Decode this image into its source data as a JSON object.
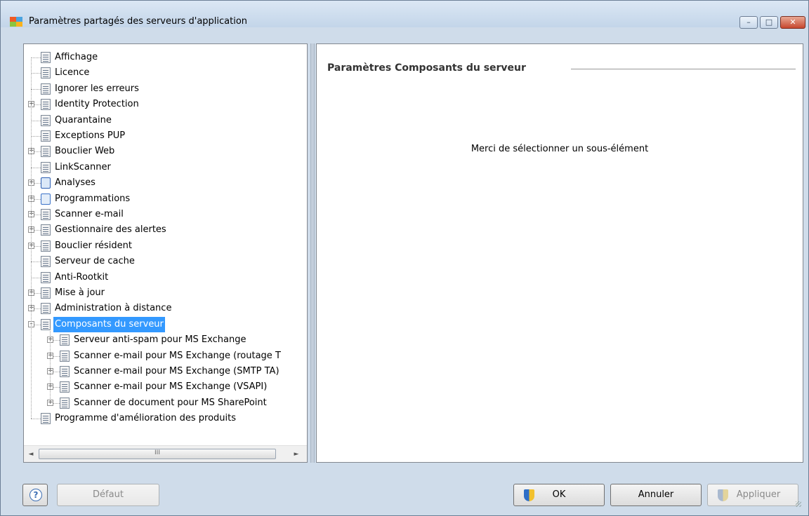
{
  "window": {
    "title": "Paramètres partagés des serveurs d'application",
    "controls": {
      "minimize": "–",
      "maximize": "□",
      "close": "✕"
    },
    "icon_colors": [
      "#f05a23",
      "#4aa3df",
      "#8bc53f",
      "#f9b21d"
    ]
  },
  "tree": {
    "items": [
      {
        "label": "Affichage",
        "expander": "",
        "icon": "document-icon",
        "level": 0
      },
      {
        "label": "Licence",
        "expander": "",
        "icon": "document-icon",
        "level": 0
      },
      {
        "label": "Ignorer les erreurs",
        "expander": "",
        "icon": "document-icon",
        "level": 0
      },
      {
        "label": "Identity Protection",
        "expander": "+",
        "icon": "document-icon",
        "level": 0
      },
      {
        "label": "Quarantaine",
        "expander": "",
        "icon": "document-icon",
        "level": 0
      },
      {
        "label": "Exceptions PUP",
        "expander": "",
        "icon": "document-icon",
        "level": 0
      },
      {
        "label": "Bouclier Web",
        "expander": "+",
        "icon": "document-icon",
        "level": 0
      },
      {
        "label": "LinkScanner",
        "expander": "",
        "icon": "document-icon",
        "level": 0
      },
      {
        "label": "Analyses",
        "expander": "+",
        "icon": "search-icon",
        "level": 0
      },
      {
        "label": "Programmations",
        "expander": "+",
        "icon": "schedule-icon",
        "level": 0
      },
      {
        "label": "Scanner e-mail",
        "expander": "+",
        "icon": "document-icon",
        "level": 0
      },
      {
        "label": "Gestionnaire des alertes",
        "expander": "+",
        "icon": "document-icon",
        "level": 0
      },
      {
        "label": "Bouclier résident",
        "expander": "+",
        "icon": "document-icon",
        "level": 0
      },
      {
        "label": "Serveur de cache",
        "expander": "",
        "icon": "document-icon",
        "level": 0
      },
      {
        "label": "Anti-Rootkit",
        "expander": "",
        "icon": "document-icon",
        "level": 0
      },
      {
        "label": "Mise à jour",
        "expander": "+",
        "icon": "document-icon",
        "level": 0
      },
      {
        "label": "Administration à distance",
        "expander": "+",
        "icon": "document-icon",
        "level": 0
      },
      {
        "label": "Composants du serveur",
        "expander": "–",
        "icon": "document-icon",
        "level": 0,
        "selected": true
      },
      {
        "label": "Serveur anti-spam pour MS Exchange",
        "expander": "+",
        "icon": "document-icon",
        "level": 1
      },
      {
        "label": "Scanner e-mail pour MS Exchange (routage T",
        "expander": "+",
        "icon": "document-icon",
        "level": 1
      },
      {
        "label": "Scanner e-mail pour MS Exchange (SMTP TA)",
        "expander": "+",
        "icon": "document-icon",
        "level": 1
      },
      {
        "label": "Scanner e-mail pour MS Exchange (VSAPI)",
        "expander": "+",
        "icon": "document-icon",
        "level": 1
      },
      {
        "label": "Scanner de document pour MS SharePoint",
        "expander": "+",
        "icon": "document-icon",
        "level": 1
      },
      {
        "label": "Programme d'amélioration des produits",
        "expander": "",
        "icon": "document-icon",
        "level": 0
      }
    ],
    "scrollbar": {
      "left_arrow": "◄",
      "right_arrow": "►",
      "thumb_grip": "III"
    }
  },
  "panel": {
    "title": "Paramètres Composants du serveur",
    "message": "Merci de sélectionner un sous-élément"
  },
  "footer": {
    "help": "?",
    "default": "Défaut",
    "ok": "OK",
    "cancel": "Annuler",
    "apply": "Appliquer"
  },
  "colors": {
    "selection": "#3399ff",
    "window_frame": "#cfdcea"
  }
}
